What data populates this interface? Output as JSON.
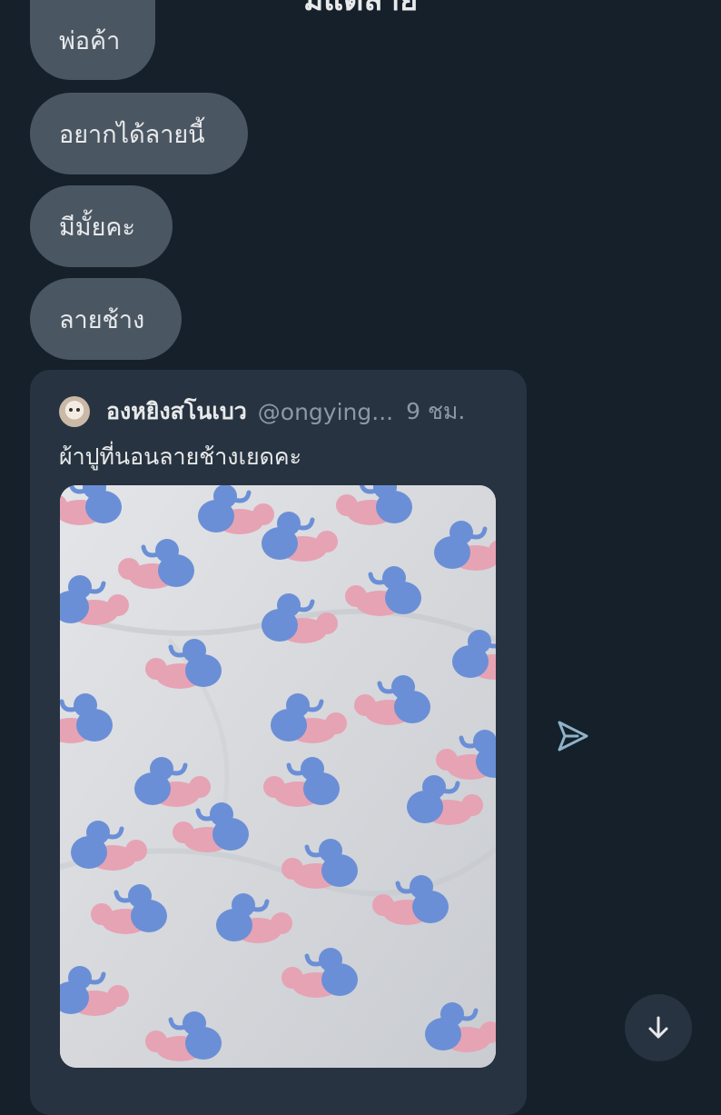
{
  "header": {
    "title": "มีแต่ลาย"
  },
  "messages": [
    {
      "text": "พ่อค้า"
    },
    {
      "text": "อยากได้ลายนี้"
    },
    {
      "text": "มีมั้ยคะ"
    },
    {
      "text": "ลายช้าง"
    }
  ],
  "quoted_post": {
    "author_name": "องหยิงสโนเบว",
    "author_handle": "@ongying...",
    "time": "9 ชม.",
    "text": "ผ้าปูที่นอนลายช้างเยดคะ",
    "image_icon": "elephant-pattern-bedsheet-photo"
  },
  "icons": {
    "send": "send-icon",
    "scroll_down": "arrow-down-icon"
  },
  "colors": {
    "background": "#15202b",
    "bubble": "#4b5663",
    "card": "#273340",
    "text_primary": "#e7e9ea",
    "text_secondary": "#8b98a5",
    "elephant_blue": "#6b8fd6",
    "elephant_pink": "#e6a3b4"
  }
}
